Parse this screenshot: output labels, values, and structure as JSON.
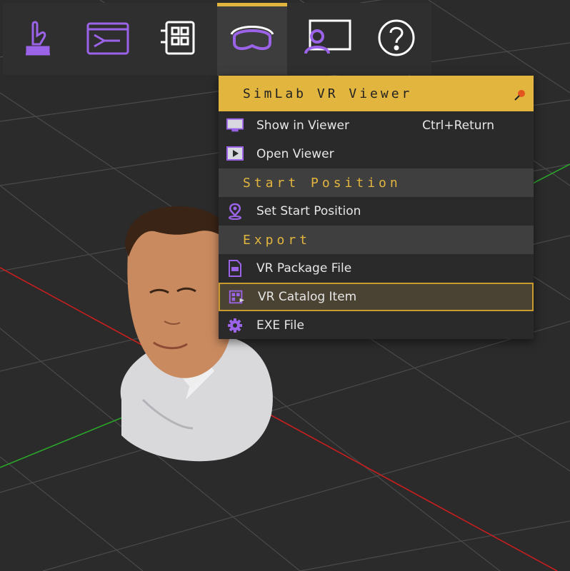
{
  "toolbar": {
    "buttons": [
      {
        "icon": "touch-icon"
      },
      {
        "icon": "flow-icon"
      },
      {
        "icon": "grid-panel-icon"
      },
      {
        "icon": "vr-headset-icon",
        "active": true
      },
      {
        "icon": "presentation-icon"
      },
      {
        "icon": "help-icon"
      }
    ]
  },
  "menu": {
    "title": "SimLab VR Viewer",
    "items": {
      "show_in_viewer": {
        "label": "Show in Viewer",
        "shortcut": "Ctrl+Return"
      },
      "open_viewer": {
        "label": "Open Viewer"
      }
    },
    "sections": {
      "start_position": {
        "header": "Start Position",
        "set_start_position": "Set Start Position"
      },
      "export": {
        "header": "Export",
        "vr_package_file": "VR Package File",
        "vr_catalog_item": "VR Catalog Item",
        "exe_file": "EXE File"
      }
    }
  },
  "colors": {
    "accent": "#e2b53e",
    "icon": "#9b63e8",
    "axis_x": "#c81e1e",
    "axis_z": "#2aa52a",
    "highlight_border": "#c99a2c"
  }
}
